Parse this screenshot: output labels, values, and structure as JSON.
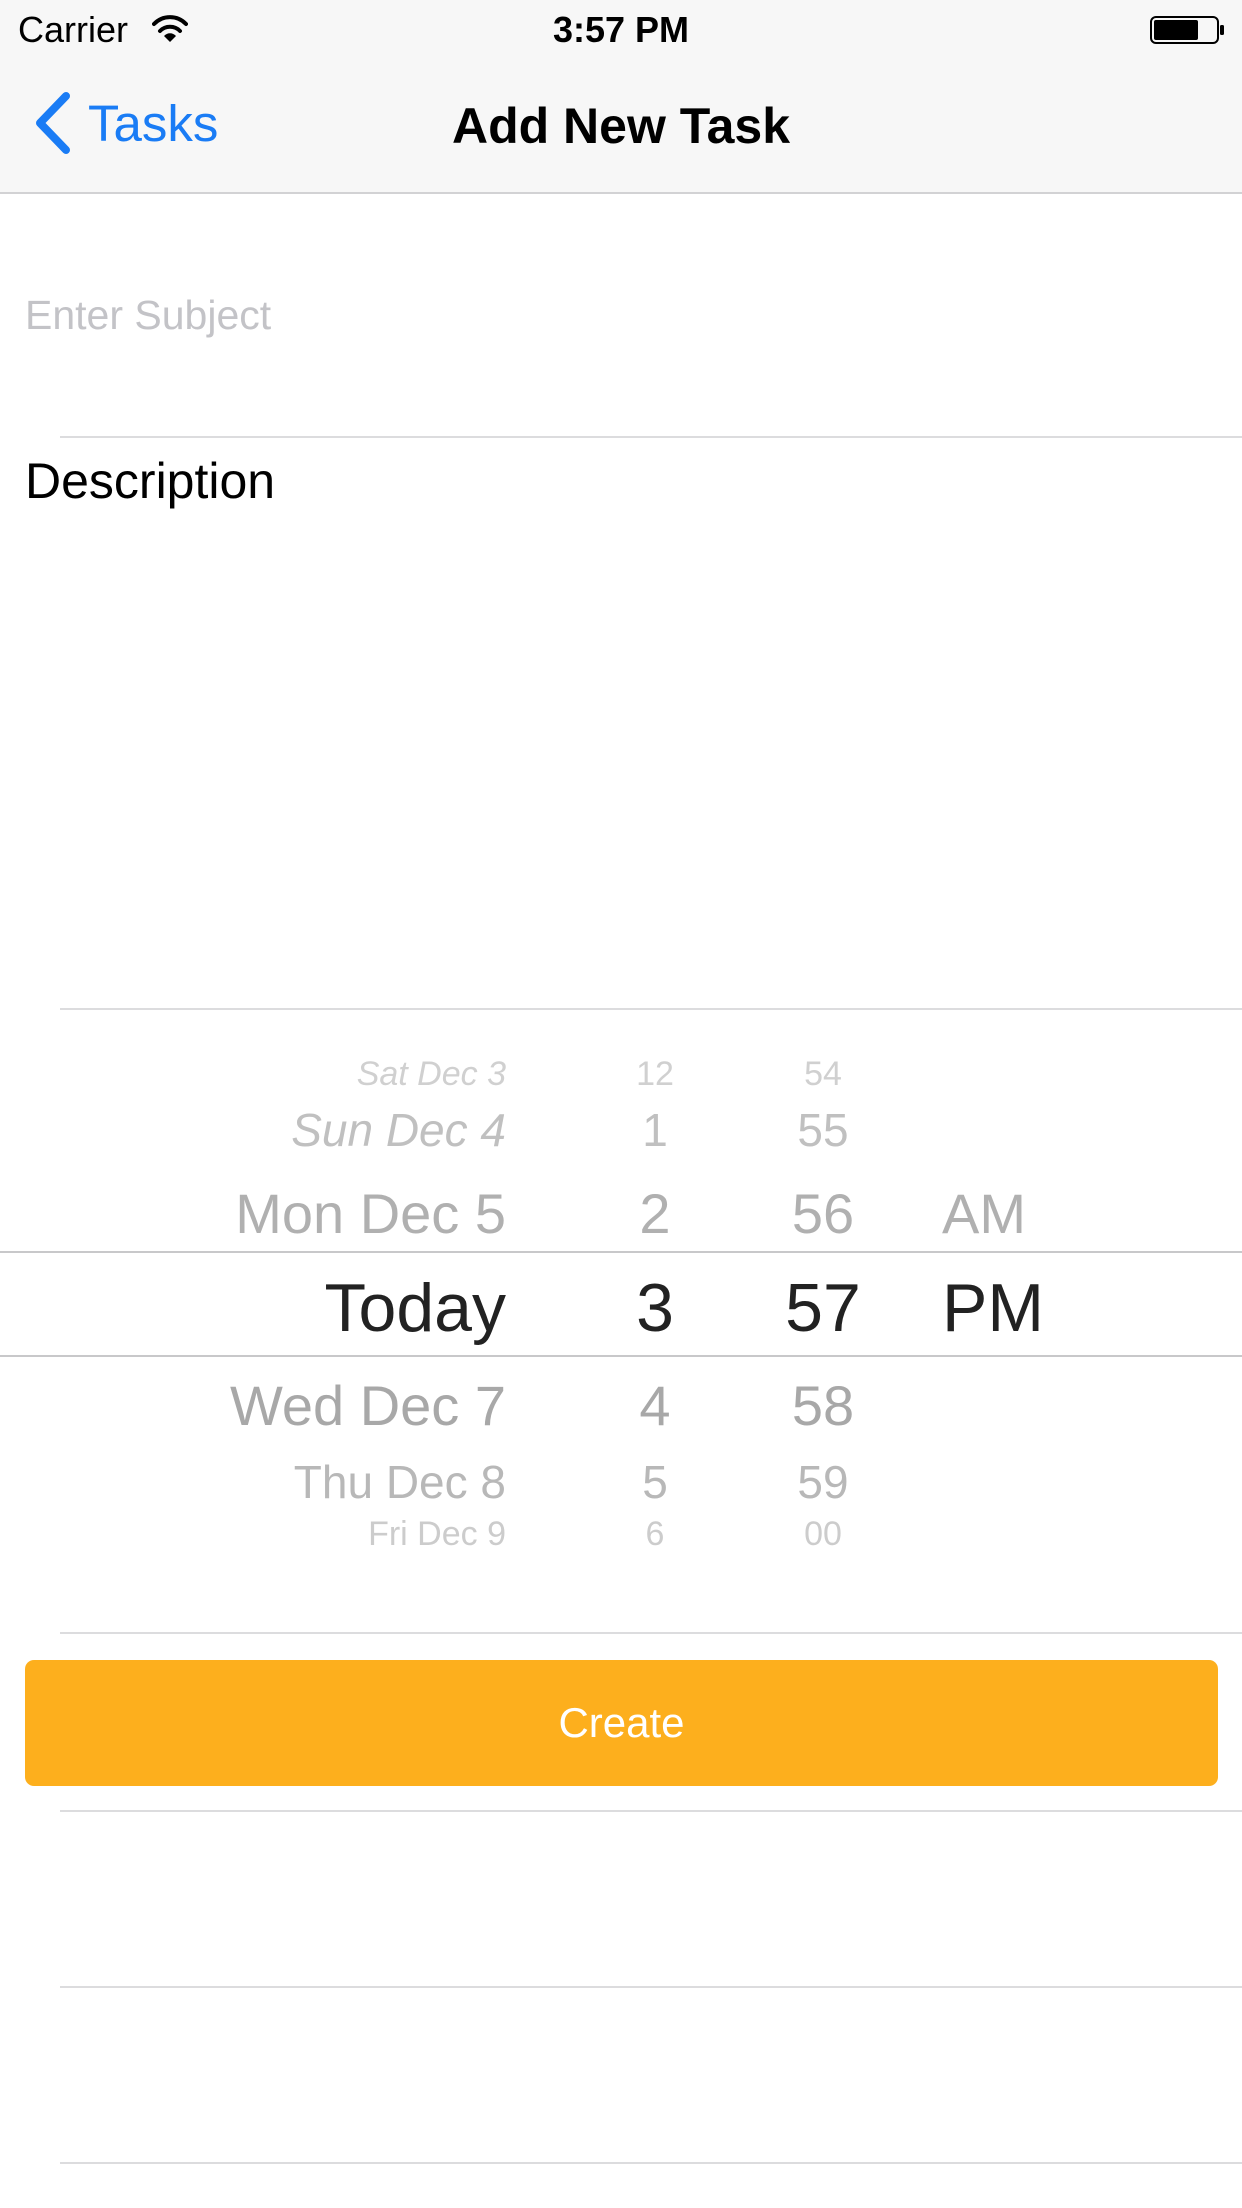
{
  "status_bar": {
    "carrier": "Carrier",
    "time": "3:57 PM"
  },
  "nav": {
    "back_label": "Tasks",
    "title": "Add New Task"
  },
  "form": {
    "subject_placeholder": "Enter Subject",
    "description_text": "Description",
    "create_label": "Create",
    "accent_color": "#fdaf1d",
    "link_color": "#1a7cf5"
  },
  "picker": {
    "date_items": [
      "Sat Dec 3",
      "Sun Dec 4",
      "Mon Dec 5",
      "Today",
      "Wed Dec 7",
      "Thu Dec 8",
      "Fri Dec 9"
    ],
    "hour_items": [
      "12",
      "1",
      "2",
      "3",
      "4",
      "5",
      "6"
    ],
    "minute_items": [
      "54",
      "55",
      "56",
      "57",
      "58",
      "59",
      "00"
    ],
    "ampm_items": [
      "AM",
      "PM"
    ],
    "selected": {
      "date": "Today",
      "hour": "3",
      "minute": "57",
      "ampm": "PM"
    }
  }
}
